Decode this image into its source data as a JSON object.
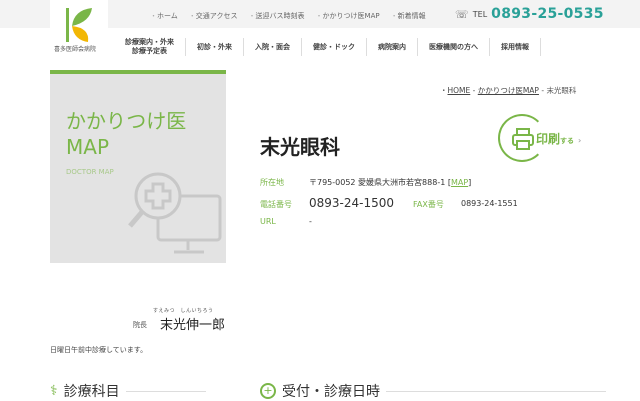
{
  "header": {
    "logo_text": "喜多医師会病院",
    "top_nav": [
      "ホーム",
      "交通アクセス",
      "送迎バス時刻表",
      "かかりつけ医MAP",
      "新着情報"
    ],
    "tel_label": "TEL",
    "tel": "0893-25-0535",
    "main_nav": [
      {
        "l1": "診療案内・外来",
        "l2": "診療予定表"
      },
      {
        "l1": "初診・外来"
      },
      {
        "l1": "入院・面会"
      },
      {
        "l1": "健診・ドック"
      },
      {
        "l1": "病院案内"
      },
      {
        "l1": "医療機関の方へ"
      },
      {
        "l1": "採用情報"
      }
    ]
  },
  "hero": {
    "title1": "かかりつけ医",
    "title2": "MAP",
    "subtitle": "DOCTOR MAP"
  },
  "breadcrumb": {
    "home": "HOME",
    "map": "かかりつけ医MAP",
    "current": "末光眼科"
  },
  "clinic": {
    "name": "末光眼科",
    "print_label": "印刷",
    "print_suffix": "する",
    "address_label": "所在地",
    "address": "〒795-0052 愛媛県大洲市若宮888-1 [",
    "map_link": "MAP",
    "address_end": "]",
    "tel_label": "電話番号",
    "tel": "0893-24-1500",
    "fax_label": "FAX番号",
    "fax": "0893-24-1551",
    "url_label": "URL",
    "url": "-",
    "director_title": "院長",
    "director_name": "末光伸一郎",
    "director_furigana": "すえみつ　しんいちろう",
    "note": "日曜日午前中診療しています。"
  },
  "sections": {
    "departments": "診療科目",
    "hours": "受付・診療日時"
  },
  "colors": {
    "accent": "#7ab648",
    "tel": "#2aa198"
  }
}
